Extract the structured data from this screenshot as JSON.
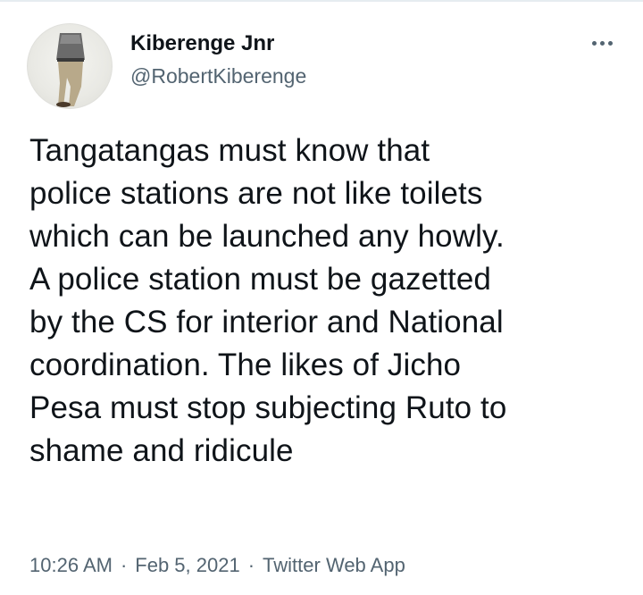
{
  "tweet": {
    "author": {
      "display_name": "Kiberenge Jnr",
      "handle": "@RobertKiberenge",
      "avatar_icon": "person-photo-avatar"
    },
    "more_icon": "more-horizontal-icon",
    "text": "Tangatangas must know that\npolice stations are not like toilets\nwhich can be launched any howly.\nA police station must be gazetted\nby the CS for interior and National\ncoordination. The likes of Jicho\nPesa must stop subjecting Ruto to\nshame and ridicule",
    "time": "10:26 AM",
    "date": "Feb 5, 2021",
    "source": "Twitter Web App",
    "separator": "·"
  },
  "colors": {
    "text": "#0f1419",
    "secondary": "#536471",
    "background": "#ffffff"
  }
}
